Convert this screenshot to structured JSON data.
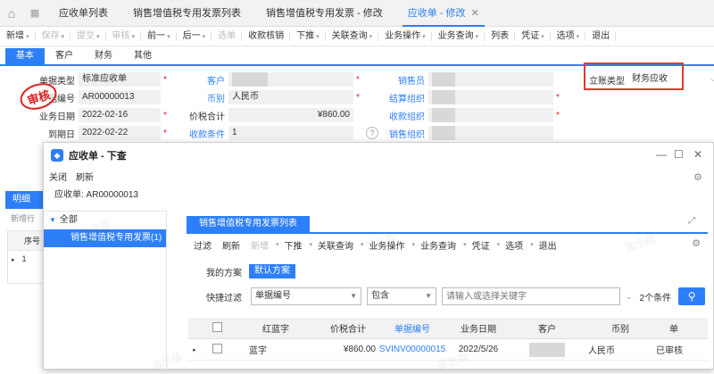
{
  "tabs": [
    {
      "label": "应收单列表"
    },
    {
      "label": "销售增值税专用发票列表"
    },
    {
      "label": "销售增值税专用发票 - 修改"
    },
    {
      "label": "应收单 - 修改"
    }
  ],
  "toolbar": {
    "items": [
      "新增",
      "保存",
      "提交",
      "审核",
      "前一",
      "后一",
      "选单",
      "收款核销",
      "下推",
      "关联查询",
      "业务操作",
      "业务查询",
      "列表",
      "凭证",
      "选项",
      "退出"
    ]
  },
  "subtabs": [
    "基本",
    "客户",
    "财务",
    "其他"
  ],
  "form": {
    "bill_type_label": "单据类型",
    "bill_type_value": "标准应收单",
    "bill_no_label": "单据编号",
    "bill_no_value": "AR00000013",
    "biz_date_label": "业务日期",
    "biz_date_value": "2022-02-16",
    "due_date_label": "到期日",
    "due_date_value": "2022-02-22",
    "customer_label": "客户",
    "currency_label": "币别",
    "currency_value": "人民币",
    "total_label": "价税合计",
    "total_value": "¥860.00",
    "terms_label": "收款条件",
    "terms_value": "1",
    "salesman_label": "销售员",
    "settle_org_label": "结算组织",
    "collect_org_label": "收款组织",
    "sales_org_label": "销售组织",
    "account_type_label": "立账类型",
    "account_type_value": "财务应收"
  },
  "stamp": "审核",
  "left_panel": {
    "tab": "明细",
    "sub": "新增行",
    "col_seq": "序号",
    "row1": "1"
  },
  "dialog": {
    "title": "应收单 - 下查",
    "menu": [
      "关闭",
      "刷新"
    ],
    "bill_label": "应收单: AR00000013",
    "tree_root": "全部",
    "tree_item": "销售增值税专用发票(1)",
    "inner_tab": "销售增值税专用发票列表",
    "inner_toolbar": [
      "过滤",
      "刷新",
      "新增",
      "下推",
      "关联查询",
      "业务操作",
      "业务查询",
      "凭证",
      "选项",
      "退出"
    ],
    "scheme_label": "我的方案",
    "scheme_btn": "默认方案",
    "filter_label": "快捷过滤",
    "filter_field": "单据编号",
    "filter_op": "包含",
    "filter_placeholder": "请输入或选择关键字",
    "filter_count": "2个条件",
    "grid_headers": [
      "红蓝字",
      "价税合计",
      "单据编号",
      "业务日期",
      "客户",
      "币别",
      "单"
    ],
    "grid_rows": [
      {
        "rb": "蓝字",
        "total": "¥860.00",
        "no": "SVINV00000015",
        "date": "2022/5/26",
        "customer": "",
        "currency": "人民币",
        "status": "已审核"
      }
    ]
  },
  "watermark": "演示版"
}
